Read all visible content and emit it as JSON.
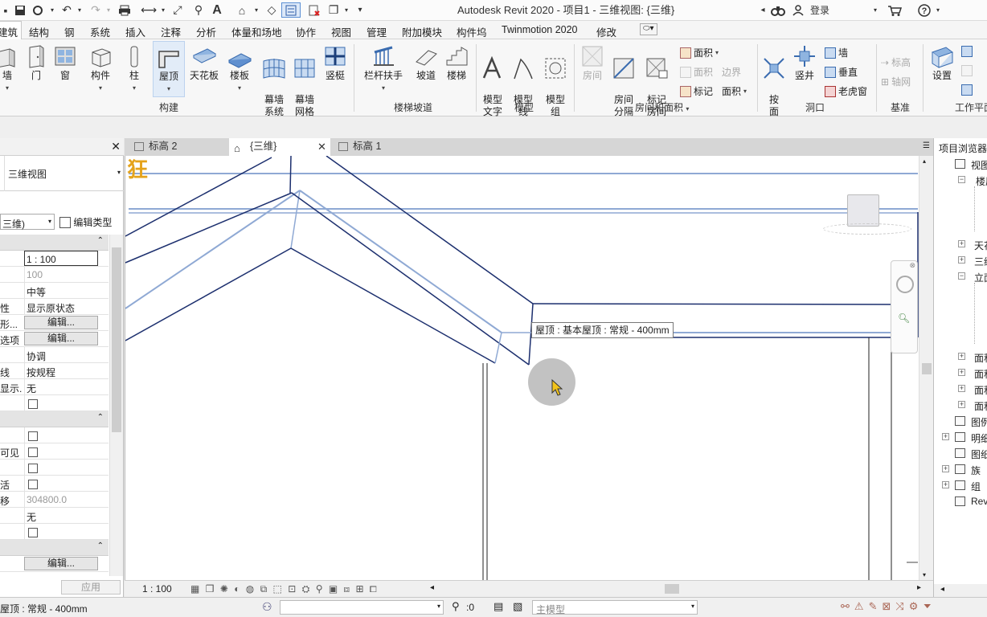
{
  "app": {
    "title": "Autodesk Revit 2020 - 项目1 - 三维视图: {三维}",
    "login_label": "登录"
  },
  "menus": [
    {
      "label": "建筑"
    },
    {
      "label": "结构"
    },
    {
      "label": "钢"
    },
    {
      "label": "系统"
    },
    {
      "label": "插入"
    },
    {
      "label": "注释"
    },
    {
      "label": "分析"
    },
    {
      "label": "体量和场地"
    },
    {
      "label": "协作"
    },
    {
      "label": "视图"
    },
    {
      "label": "管理"
    },
    {
      "label": "附加模块"
    },
    {
      "label": "构件坞"
    },
    {
      "label": "Twinmotion 2020"
    },
    {
      "label": "修改"
    }
  ],
  "ribbon": {
    "build": {
      "wall": "墙",
      "door": "门",
      "window": "窗",
      "component": "构件",
      "column": "柱",
      "roof": "屋顶",
      "ceiling": "天花板",
      "floor": "楼板",
      "curtain_system": "幕墙\n系统",
      "curtain_grid": "幕墙\n网格",
      "mullion": "竖梃",
      "panel_label": "构建"
    },
    "stairs": {
      "railing": "栏杆扶手",
      "ramp": "坡道",
      "stair": "楼梯",
      "panel_label": "楼梯坡道"
    },
    "model": {
      "model_text": "模型\n文字",
      "model_line": "模型\n线",
      "model_group": "模型\n组",
      "panel_label": "模型"
    },
    "room": {
      "room": "房间",
      "room_separator": "房间\n分隔",
      "tag_room": "标记\n房间",
      "area": "面积",
      "area_2": "面积",
      "boundary": "边界",
      "tag": "标记",
      "area_3": "面积",
      "panel_label": "房间和面积"
    },
    "opening": {
      "by_face": "按\n面",
      "shaft": "竖井",
      "wall": "墙",
      "vertical": "垂直",
      "dormer": "老虎窗",
      "panel_label": "洞口"
    },
    "datum": {
      "level": "标高",
      "grid": "轴网",
      "panel_label": "基准"
    },
    "workplane": {
      "set": "设置",
      "panel_label": "工作平面"
    }
  },
  "properties": {
    "type_name": "三维视图",
    "instance_selector": "三维)",
    "edit_type": "编辑类型",
    "rows": [
      {
        "key": "",
        "value": "1 : 100",
        "kind": "input"
      },
      {
        "key": "",
        "value": "100",
        "kind": "gray"
      },
      {
        "key": "",
        "value": "中等",
        "kind": "text"
      },
      {
        "key": "性",
        "value": "显示原状态",
        "kind": "text"
      },
      {
        "key": "形...",
        "value": "编辑...",
        "kind": "button"
      },
      {
        "key": "选项",
        "value": "编辑...",
        "kind": "button"
      },
      {
        "key": "",
        "value": "协调",
        "kind": "text"
      },
      {
        "key": "线",
        "value": "按规程",
        "kind": "text"
      },
      {
        "key": "显示...",
        "value": "无",
        "kind": "text"
      },
      {
        "key": "",
        "value": "",
        "kind": "check"
      }
    ],
    "rows2": [
      {
        "key": "",
        "value": "",
        "kind": "check"
      },
      {
        "key": "可见",
        "value": "",
        "kind": "check"
      },
      {
        "key": "",
        "value": "",
        "kind": "check"
      },
      {
        "key": "活",
        "value": "",
        "kind": "check"
      },
      {
        "key": "移",
        "value": "304800.0",
        "kind": "gray"
      },
      {
        "key": "",
        "value": "无",
        "kind": "text"
      },
      {
        "key": "",
        "value": "",
        "kind": "check"
      }
    ],
    "rows3": [
      {
        "key": "",
        "value": "编辑...",
        "kind": "button"
      }
    ],
    "apply": "应用"
  },
  "tabs": [
    {
      "label": "标高 2"
    },
    {
      "label": "{三维}"
    },
    {
      "label": "标高 1"
    }
  ],
  "canvas": {
    "tooltip": "屋顶 : 基本屋顶 : 常规 - 400mm"
  },
  "view_bar": {
    "scale": "1 : 100"
  },
  "browser": {
    "title": "项目浏览器",
    "items": [
      {
        "label": "视图"
      },
      {
        "label": "楼层"
      },
      {
        "label": "天花"
      },
      {
        "label": "三维"
      },
      {
        "label": "立面"
      },
      {
        "label": "面积"
      },
      {
        "label": "面积"
      },
      {
        "label": "面积"
      },
      {
        "label": "面积"
      },
      {
        "label": "图例"
      },
      {
        "label": "明细"
      },
      {
        "label": "图纸"
      },
      {
        "label": "族"
      },
      {
        "label": "组"
      },
      {
        "label": "Rev"
      }
    ]
  },
  "status": {
    "text": "屋顶 : 常规 - 400mm",
    "worksets": ":0",
    "model": "主模型"
  }
}
